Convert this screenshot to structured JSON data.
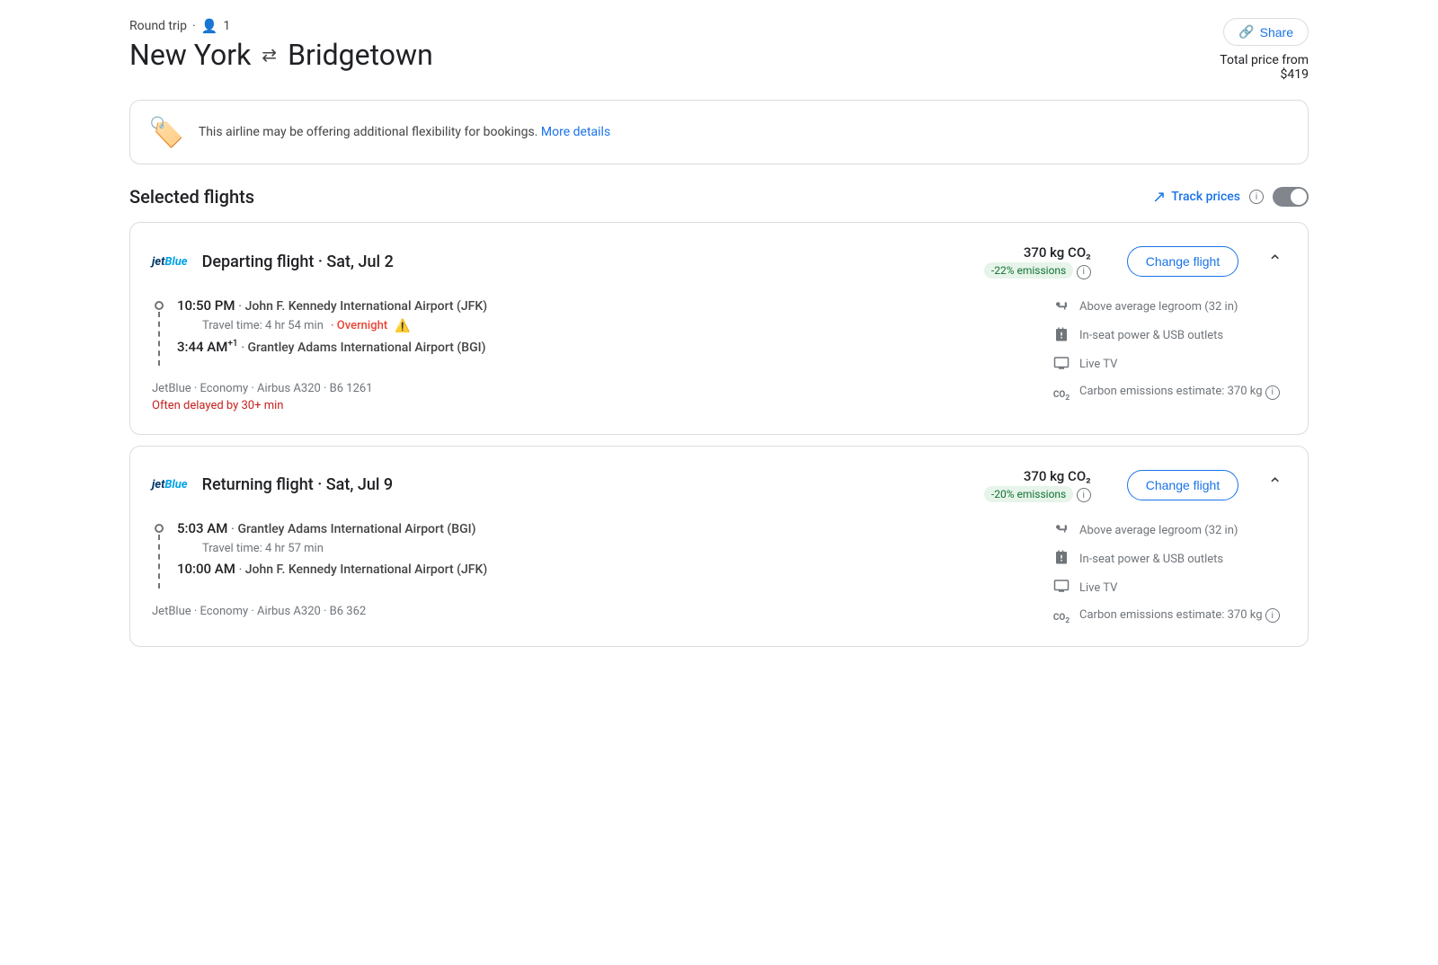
{
  "header": {
    "share_label": "Share",
    "trip_type": "Round trip",
    "passengers": "1",
    "origin": "New York",
    "destination": "Bridgetown",
    "price_label": "Total price from",
    "price": "$419",
    "arrow": "⇄"
  },
  "banner": {
    "text": "This airline may be offering additional flexibility for bookings.",
    "link_text": "More details"
  },
  "selected_flights": {
    "title": "Selected flights",
    "track_prices_label": "Track prices"
  },
  "flights": [
    {
      "airline_logo": "jetBlue",
      "flight_type": "Departing flight",
      "date": "Sat, Jul 2",
      "emissions_kg": "370 kg CO₂",
      "emissions_badge": "-22% emissions",
      "change_label": "Change flight",
      "departure_time": "10:50 PM",
      "departure_airport": "John F. Kennedy International Airport (JFK)",
      "travel_time": "Travel time: 4 hr 54 min",
      "overnight": "Overnight",
      "arrival_time": "3:44 AM",
      "arrival_superscript": "+1",
      "arrival_airport": "Grantley Adams International Airport (BGI)",
      "flight_meta": "JetBlue · Economy · Airbus A320 · B6 1261",
      "delay_warning": "Often delayed by 30+ min",
      "amenities": [
        {
          "icon": "seat",
          "text": "Above average legroom (32 in)"
        },
        {
          "icon": "power",
          "text": "In-seat power & USB outlets"
        },
        {
          "icon": "tv",
          "text": "Live TV"
        },
        {
          "icon": "co2",
          "text": "Carbon emissions estimate: 370 kg"
        }
      ]
    },
    {
      "airline_logo": "jetBlue",
      "flight_type": "Returning flight",
      "date": "Sat, Jul 9",
      "emissions_kg": "370 kg CO₂",
      "emissions_badge": "-20% emissions",
      "change_label": "Change flight",
      "departure_time": "5:03 AM",
      "departure_airport": "Grantley Adams International Airport (BGI)",
      "travel_time": "Travel time: 4 hr 57 min",
      "overnight": null,
      "arrival_time": "10:00 AM",
      "arrival_superscript": "",
      "arrival_airport": "John F. Kennedy International Airport (JFK)",
      "flight_meta": "JetBlue · Economy · Airbus A320 · B6 362",
      "delay_warning": null,
      "amenities": [
        {
          "icon": "seat",
          "text": "Above average legroom (32 in)"
        },
        {
          "icon": "power",
          "text": "In-seat power & USB outlets"
        },
        {
          "icon": "tv",
          "text": "Live TV"
        },
        {
          "icon": "co2",
          "text": "Carbon emissions estimate: 370 kg"
        }
      ]
    }
  ]
}
